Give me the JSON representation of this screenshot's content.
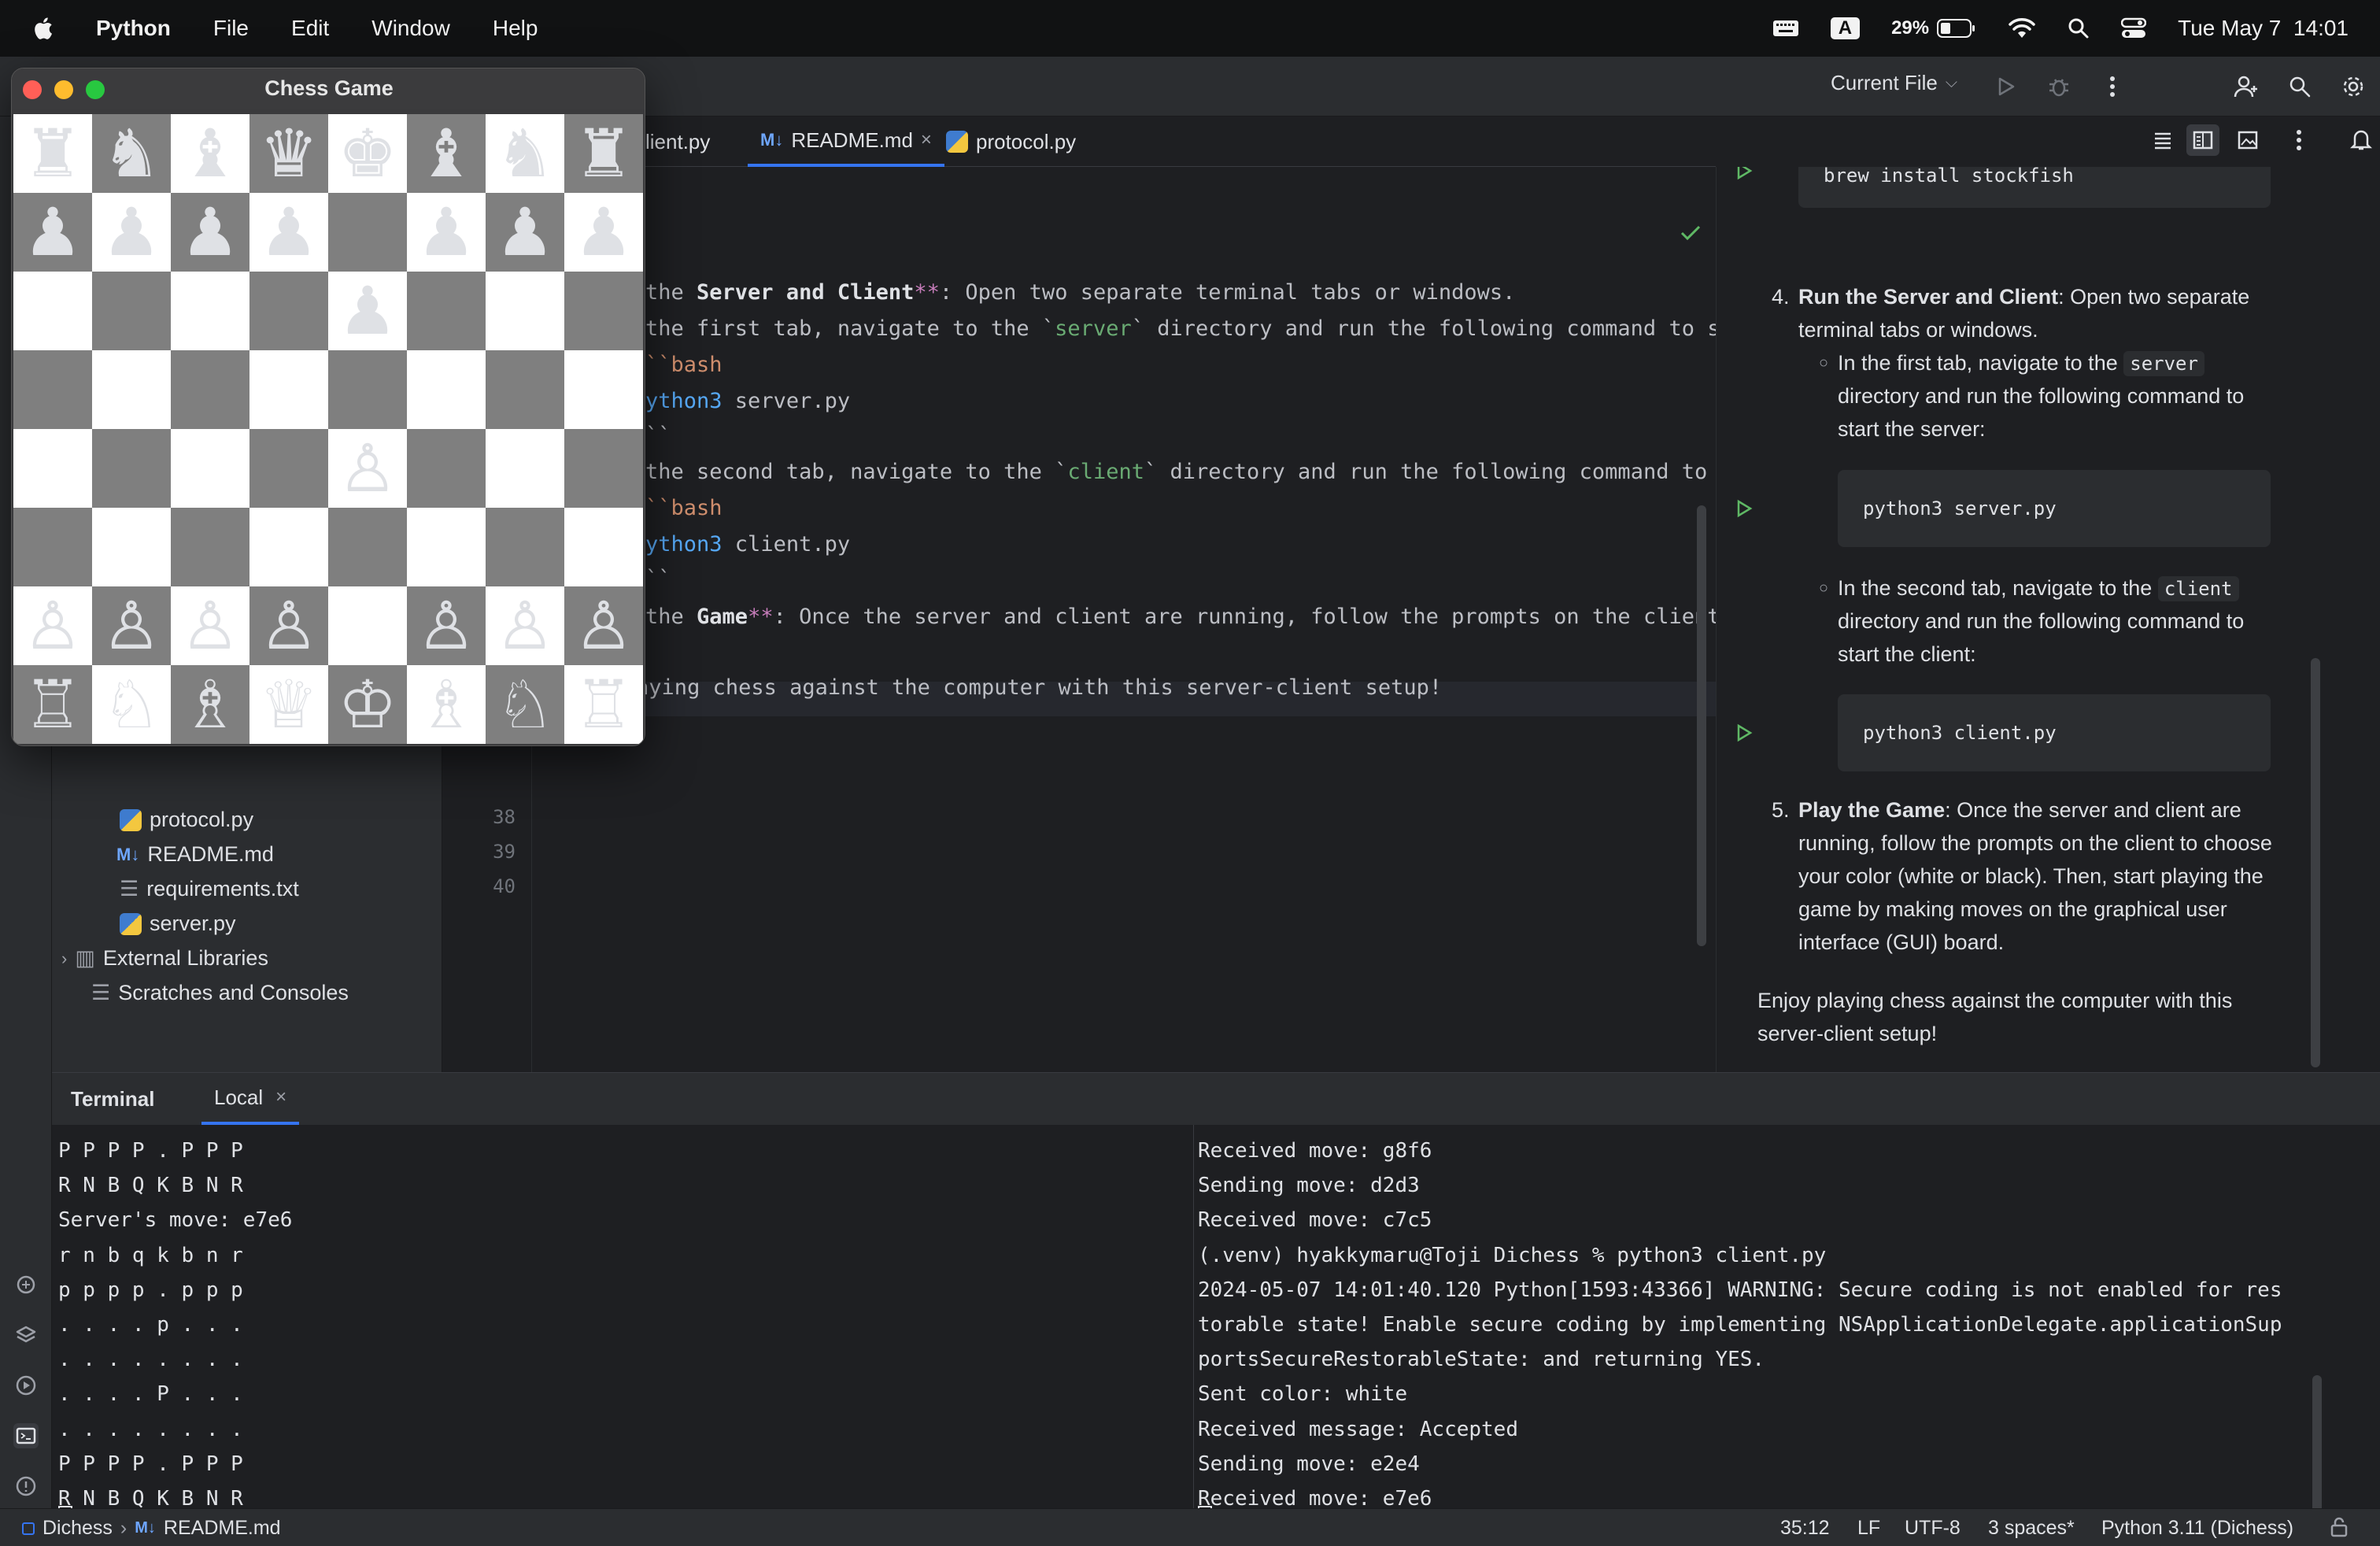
{
  "menubar": {
    "app_name": "Python",
    "menus": [
      "File",
      "Edit",
      "Window",
      "Help"
    ],
    "battery": "29%",
    "datetime": "Tue May 7  14:01",
    "input_source": "A"
  },
  "toolbar": {
    "run_config": "Current File"
  },
  "tabs": [
    {
      "label": "lient.py",
      "type": "py"
    },
    {
      "label": "README.md",
      "type": "md",
      "active": true
    },
    {
      "label": "protocol.py",
      "type": "py"
    }
  ],
  "project_tree": [
    {
      "label": "protocol.py",
      "icon": "python-file-icon"
    },
    {
      "label": "README.md",
      "icon": "markdown-file-icon"
    },
    {
      "label": "requirements.txt",
      "icon": "text-file-icon"
    },
    {
      "label": "server.py",
      "icon": "python-file-icon"
    },
    {
      "label": "External Libraries",
      "icon": "library-icon"
    },
    {
      "label": "Scratches and Consoles",
      "icon": "scratches-icon"
    }
  ],
  "editor": {
    "line_numbers": [
      "38",
      "39",
      "40"
    ],
    "lines": [
      {
        "parts": [
          [
            "",
            "the "
          ],
          [
            "bold",
            "Server and Client"
          ],
          [
            "kw",
            "**"
          ],
          [
            "",
            ": Open two separate terminal tabs or windows."
          ]
        ]
      },
      {
        "parts": [
          [
            "",
            "the first tab, navigate to the `"
          ],
          [
            "str",
            "server"
          ],
          [
            "",
            "` directory and run the following command to star"
          ]
        ]
      },
      {
        "parts": [
          [
            "lang",
            "``bash"
          ]
        ]
      },
      {
        "parts": [
          [
            "cmd",
            "ython3"
          ],
          [
            "",
            " server.py"
          ]
        ]
      },
      {
        "parts": [
          [
            "",
            "``"
          ]
        ]
      },
      {
        "parts": [
          [
            "",
            "the second tab, navigate to the `"
          ],
          [
            "str",
            "client"
          ],
          [
            "",
            "` directory and run the following command to sta"
          ]
        ]
      },
      {
        "parts": [
          [
            "lang",
            "``bash"
          ]
        ]
      },
      {
        "parts": [
          [
            "cmd",
            "ython3"
          ],
          [
            "",
            " client.py"
          ]
        ]
      },
      {
        "parts": [
          [
            "",
            "``"
          ]
        ]
      },
      {
        "parts": [
          [
            "",
            "the "
          ],
          [
            "bold",
            "Game"
          ],
          [
            "kw",
            "**"
          ],
          [
            "",
            ": Once the server and client are running, follow the prompts on the client t"
          ]
        ]
      },
      {
        "parts": [
          [
            "",
            "Enjoy playing chess against the computer with this server-client setup!"
          ]
        ]
      }
    ]
  },
  "preview": {
    "top_code": "brew install stockfish",
    "step4_num": "4.",
    "step4_bold": "Run the Server and Client",
    "step4_text_1": ": Open two separate",
    "step4_text_2": "terminal tabs or windows.",
    "sub1_a": "In the first tab, navigate to the",
    "sub1_code": "server",
    "sub1_b": "directory and run the following command to",
    "sub1_c": "start the server:",
    "code1": "python3 server.py",
    "sub2_a": "In the second tab, navigate to the",
    "sub2_code": "client",
    "sub2_b": "directory and run the following command to",
    "sub2_c": "start the client:",
    "code2": "python3 client.py",
    "step5_num": "5.",
    "step5_bold": "Play the Game",
    "step5_l1": ": Once the server and client are",
    "step5_l2": "running, follow the prompts on the client to choose",
    "step5_l3": "your color (white or black). Then, start playing the",
    "step5_l4": "game by making moves on the graphical user",
    "step5_l5": "interface (GUI) board.",
    "enjoy_l1": "Enjoy playing chess against the computer with this",
    "enjoy_l2": "server-client setup!"
  },
  "terminal": {
    "title": "Terminal",
    "tab": "Local",
    "left_lines": [
      "P P P P . P P P",
      "R N B Q K B N R",
      "Server's move: e7e6",
      "r n b q k b n r",
      "p p p p . p p p",
      ". . . . p . . .",
      ". . . . . . . .",
      ". . . . P . . .",
      ". . . . . . . .",
      "P P P P . P P P",
      "R N B Q K B N R"
    ],
    "right_lines": [
      "Received move: g8f6",
      "Sending move: d2d3",
      "Received move: c7c5",
      "(.venv) hyakkymaru@Toji Dichess % python3 client.py",
      "2024-05-07 14:01:40.120 Python[1593:43366] WARNING: Secure coding is not enabled for res",
      "torable state! Enable secure coding by implementing NSApplicationDelegate.applicationSup",
      "portsSecureRestorableState: and returning YES.",
      "Sent color: white",
      "Received message: Accepted",
      "Sending move: e2e4",
      "Received move: e7e6"
    ]
  },
  "statusbar": {
    "project": "Dichess",
    "file": "README.md",
    "position": "35:12",
    "line_sep": "LF",
    "encoding": "UTF-8",
    "indent": "3 spaces*",
    "interpreter": "Python 3.11 (Dichess)"
  },
  "chess": {
    "title": "Chess Game",
    "board": [
      [
        "♜",
        "♞",
        "♝",
        "♛",
        "♚",
        "♝",
        "♞",
        "♜"
      ],
      [
        "♟",
        "♟",
        "♟",
        "♟",
        "",
        "♟",
        "♟",
        "♟"
      ],
      [
        "",
        "",
        "",
        "",
        "♟",
        "",
        "",
        ""
      ],
      [
        "",
        "",
        "",
        "",
        "",
        "",
        "",
        ""
      ],
      [
        "",
        "",
        "",
        "",
        "♙",
        "",
        "",
        ""
      ],
      [
        "",
        "",
        "",
        "",
        "",
        "",
        "",
        ""
      ],
      [
        "♙",
        "♙",
        "♙",
        "♙",
        "",
        "♙",
        "♙",
        "♙"
      ],
      [
        "♖",
        "♘",
        "♗",
        "♕",
        "♔",
        "♗",
        "♘",
        "♖"
      ]
    ]
  },
  "colors": {
    "accent": "#3574f0",
    "traffic_red": "#ff5f57",
    "traffic_yellow": "#febc2e",
    "traffic_green": "#28c840"
  }
}
